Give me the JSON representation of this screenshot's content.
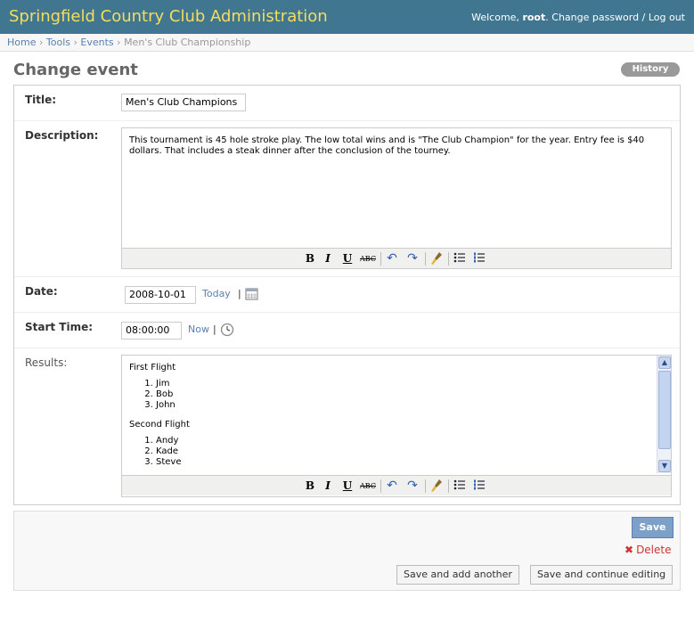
{
  "header": {
    "site_title": "Springfield Country Club Administration",
    "welcome_prefix": "Welcome,",
    "username": "root",
    "welcome_suffix": ".",
    "change_password": "Change password",
    "separator": "/",
    "logout": "Log out"
  },
  "breadcrumbs": {
    "home": "Home",
    "tools": "Tools",
    "events": "Events",
    "current": "Men's Club Championship",
    "sep": "›"
  },
  "page": {
    "title": "Change event",
    "history_button": "History"
  },
  "form": {
    "title": {
      "label": "Title:",
      "value": "Men's Club Champions"
    },
    "description": {
      "label": "Description:",
      "text": "This tournament is 45 hole stroke play. The low total wins and is \"The Club Champion\" for the year. Entry fee is $40 dollars. That includes a steak dinner after the conclusion of the tourney."
    },
    "date": {
      "label": "Date:",
      "value": "2008-10-01",
      "today_link": "Today",
      "sep": "|"
    },
    "start_time": {
      "label": "Start Time:",
      "value": "08:00:00",
      "now_link": "Now",
      "sep": "|"
    },
    "results": {
      "label": "Results:",
      "first_heading": "First Flight",
      "first_list": [
        "Jim",
        "Bob",
        "John"
      ],
      "second_heading": "Second Flight",
      "second_list": [
        "Andy",
        "Kade",
        "Steve"
      ]
    }
  },
  "toolbar": {
    "bold": "B",
    "italic": "I",
    "underline": "U",
    "strike": "ABC",
    "icons": [
      "bold-icon",
      "italic-icon",
      "underline-icon",
      "strikethrough-icon",
      "undo-icon",
      "redo-icon",
      "cleanup-icon",
      "bullet-list-icon",
      "numbered-list-icon"
    ]
  },
  "submit": {
    "save": "Save",
    "delete": "Delete",
    "save_add_another": "Save and add another",
    "save_continue": "Save and continue editing"
  },
  "colors": {
    "header_bg": "#417690",
    "site_title": "#f5dd5d",
    "link": "#5b80b2",
    "save_bg": "#7ca0c7",
    "delete": "#cc3434"
  }
}
